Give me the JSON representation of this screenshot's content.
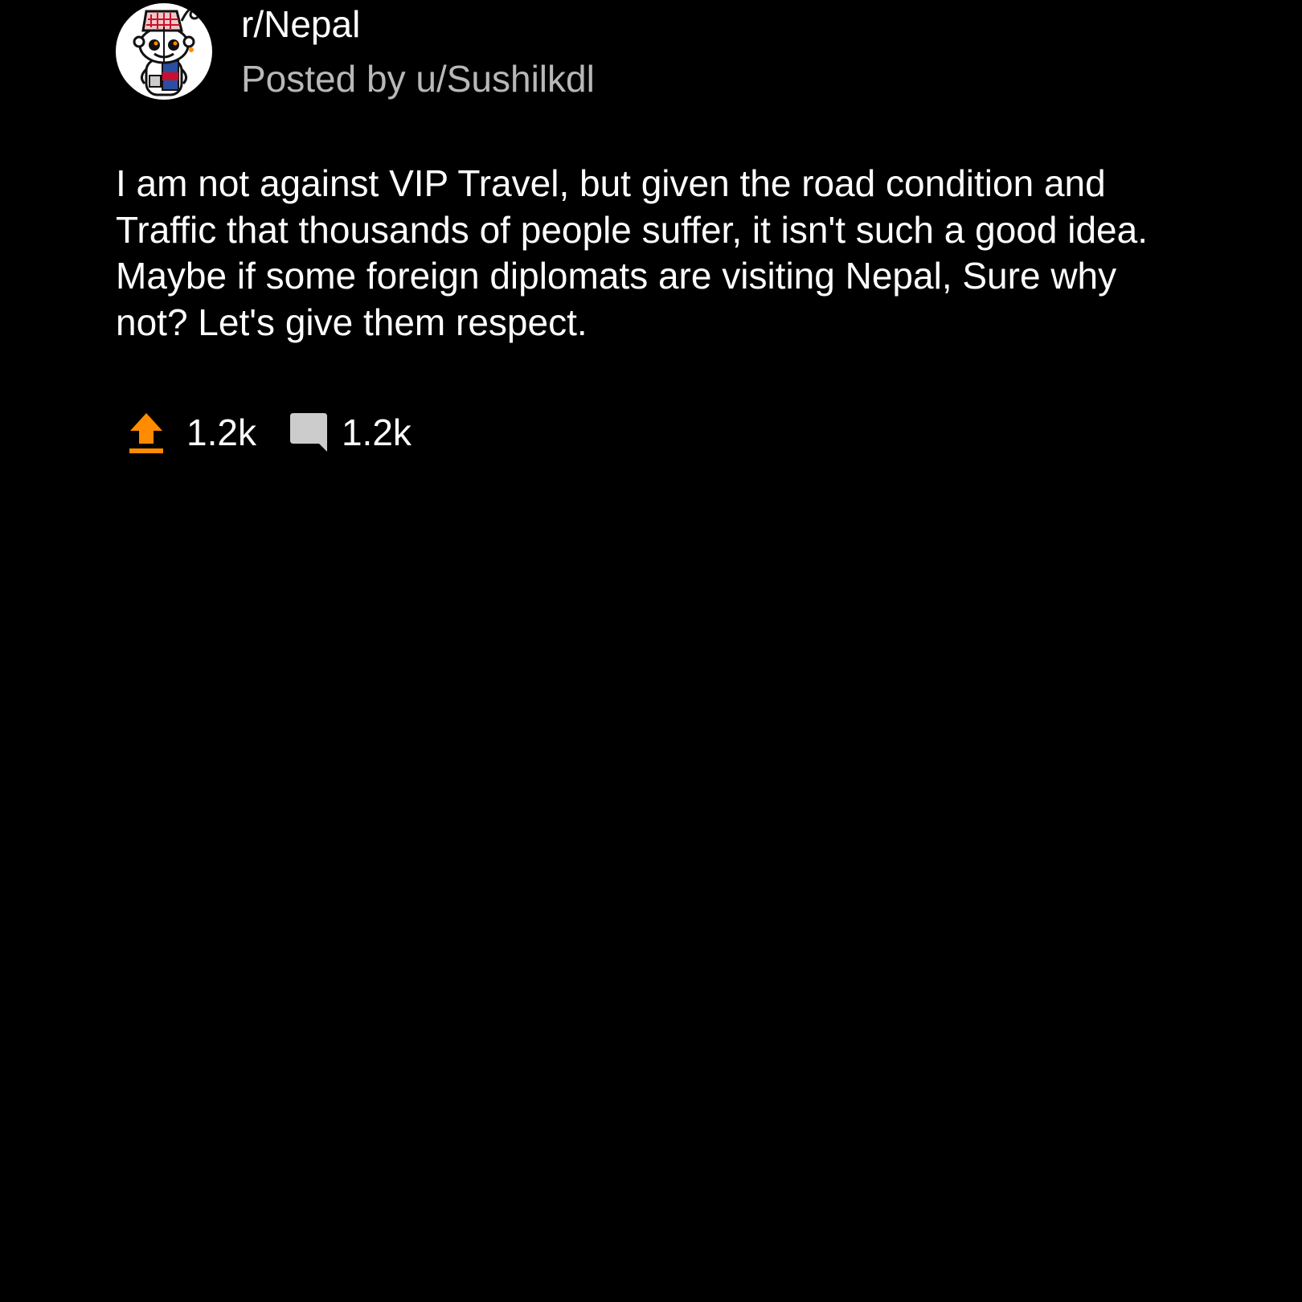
{
  "post": {
    "subreddit": "r/Nepal",
    "posted_by": "Posted by u/Sushilkdl",
    "avatar_icon": "snoo-dhaka-topi-avatar",
    "body": "I am not against VIP Travel, but given the road condition and Traffic that thousands of people suffer, it isn't such a good idea. Maybe if some foreign diplomats are visiting Nepal, Sure why not? Let's give them respect.",
    "upvotes": "1.2k",
    "comments": "1.2k",
    "upvote_icon": "upvote-arrow-icon",
    "comment_icon": "comment-bubble-icon"
  },
  "colors": {
    "background": "#000000",
    "text": "#ffffff",
    "muted_text": "#b8b8b8",
    "upvote_accent": "#ff8b00",
    "comment_icon": "#cccccc"
  }
}
